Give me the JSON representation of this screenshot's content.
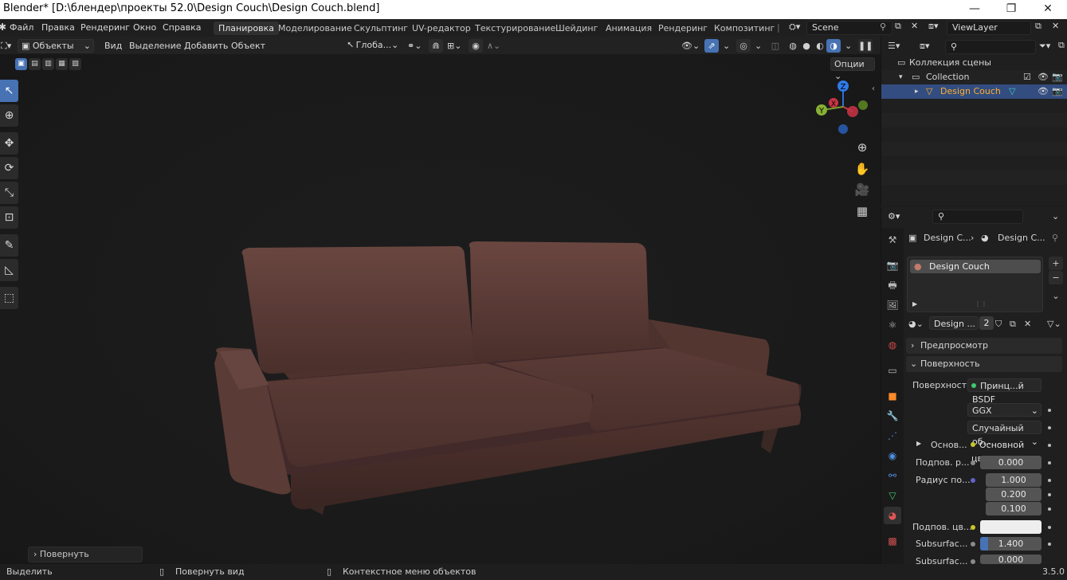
{
  "window": {
    "title": "Blender* [D:\\блендер\\проекты 52.0\\Design Couch\\Design Couch.blend]",
    "controls": [
      "—",
      "❐",
      "✕"
    ]
  },
  "menu": [
    "Файл",
    "Правка",
    "Рендеринг",
    "Окно",
    "Справка"
  ],
  "workspaces": [
    "Планировка",
    "Моделирование",
    "Скульптинг",
    "UV-редактор",
    "Текстурирование",
    "Шейдинг",
    "Анимация",
    "Рендеринг",
    "Композитинг"
  ],
  "active_workspace": "Планировка",
  "scene": {
    "name": "Scene",
    "view_layer": "ViewLayer"
  },
  "viewport": {
    "mode": "Объекты",
    "menus": [
      "Вид",
      "Выделение",
      "Добавить",
      "Объект"
    ],
    "transform_orientation": "Глоба...",
    "options_label": "Опции",
    "gizmo_axes": [
      "Z",
      "X",
      "Y"
    ],
    "operator_panel": "Повернуть"
  },
  "statusbar": {
    "left": "Выделить",
    "middle": "Повернуть вид",
    "right": "Контекстное меню объектов",
    "version": "3.5.0"
  },
  "outliner": {
    "root": "Коллекция сцены",
    "collection": "Collection",
    "object": "Design Couch"
  },
  "properties": {
    "breadcrumb_object": "Design C...",
    "breadcrumb_material": "Design C...",
    "slot": "Design Couch",
    "material_name": "Design ...",
    "users": "2",
    "panels": {
      "preview": "Предпросмотр",
      "surface": "Поверхность"
    },
    "surface_label": "Поверхность",
    "surface_shader": "Принц...й BSDF",
    "distribution": "GGX",
    "subsurface_method": "Случайный об...",
    "base_label": "Основ...",
    "base_value": "Основной цвет",
    "subsurface_label": "Подпов. р...",
    "subsurface_value": "0.000",
    "radius_label": "Радиус по...",
    "radius_values": [
      "1.000",
      "0.200",
      "0.100"
    ],
    "subsurface_color_label": "Подпов. цв...",
    "subsurface_color": "#eeeeee",
    "ior_label": "Subsurfac...",
    "ior_value": "1.400",
    "anisotropy_label": "Subsurfac...",
    "anisotropy_value": "0.000"
  },
  "colors": {
    "accent": "#4772b3",
    "selection": "#334d80",
    "active_text": "#ffaf29",
    "couch": "#5a3a33"
  }
}
